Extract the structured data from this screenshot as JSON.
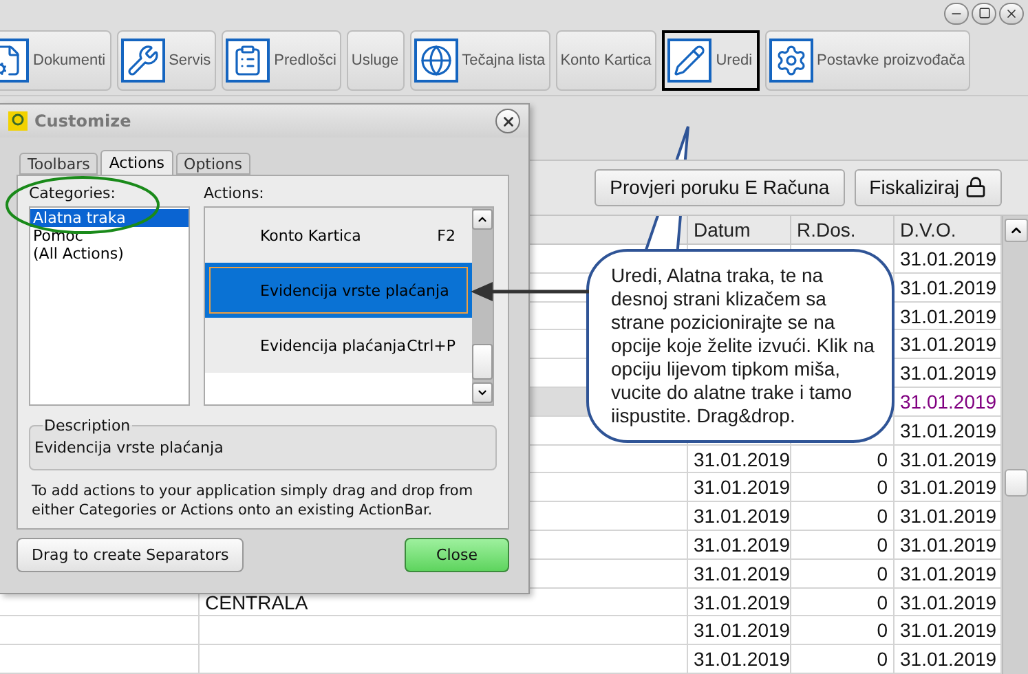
{
  "toolbar": [
    {
      "label": "Dokumenti",
      "kind": "icon",
      "selected": false
    },
    {
      "label": "Servis",
      "kind": "icon",
      "selected": false
    },
    {
      "label": "Predlošci",
      "kind": "icon",
      "selected": false
    },
    {
      "label": "Usluge",
      "kind": "text",
      "selected": false
    },
    {
      "label": "Tečajna lista",
      "kind": "icon",
      "selected": false
    },
    {
      "label": "Konto Kartica",
      "kind": "text",
      "selected": false
    },
    {
      "label": "Uredi",
      "kind": "icon",
      "selected": true
    },
    {
      "label": "Postavke proizvođača",
      "kind": "icon",
      "selected": false
    }
  ],
  "action_buttons": [
    {
      "label": "Provjeri poruku E Računa",
      "kind": "text"
    },
    {
      "label": "Fiskaliziraj",
      "kind": "lock"
    }
  ],
  "table": {
    "columns": [
      "Datum",
      "R.Dos.",
      "D.V.O."
    ],
    "rows": [
      {
        "dvo": "31.01.2019",
        "selected": false
      },
      {
        "dvo": "31.01.2019",
        "selected": false
      },
      {
        "dvo": "31.01.2019",
        "selected": false
      },
      {
        "dvo": "31.01.2019",
        "selected": false
      },
      {
        "dvo": "31.01.2019",
        "selected": false
      },
      {
        "dvo": "31.01.2019",
        "selected": true
      },
      {
        "dvo": "31.01.2019",
        "selected": false
      },
      {
        "datum": "31.01.2019",
        "r_dos": "0",
        "dvo": "31.01.2019",
        "selected": false
      },
      {
        "datum": "31.01.2019",
        "r_dos": "0",
        "dvo": "31.01.2019",
        "selected": false
      },
      {
        "datum": "31.01.2019",
        "r_dos": "0",
        "dvo": "31.01.2019",
        "selected": false
      },
      {
        "datum": "31.01.2019",
        "r_dos": "0",
        "dvo": "31.01.2019",
        "selected": false
      },
      {
        "datum": "31.01.2019",
        "r_dos": "0",
        "dvo": "31.01.2019",
        "selected": false
      },
      {
        "column_2": "CENTRALA",
        "datum": "31.01.2019",
        "r_dos": "0",
        "dvo": "31.01.2019",
        "selected": false
      },
      {
        "datum": "31.01.2019",
        "r_dos": "0",
        "dvo": "31.01.2019",
        "selected": false
      },
      {
        "datum": "31.01.2019",
        "r_dos": "0",
        "dvo": "31.01.2019",
        "selected": false
      }
    ]
  },
  "dialog": {
    "title": "Customize",
    "tabs": [
      {
        "label": "Toolbars",
        "selected": false
      },
      {
        "label": "Actions",
        "selected": true
      },
      {
        "label": "Options",
        "selected": false
      }
    ],
    "categories_label": "Categories:",
    "categories": [
      {
        "label": "Alatna traka",
        "selected": true
      },
      {
        "label": "Pomoc",
        "selected": false
      },
      {
        "label": "(All Actions)",
        "selected": false
      }
    ],
    "actions_label": "Actions:",
    "actions": [
      {
        "label": "Konto Kartica",
        "shortcut": "F2",
        "selected": false
      },
      {
        "label": "Evidencija vrste plaćanja",
        "selected": true
      },
      {
        "label": "Evidencija plaćanja",
        "shortcut": "Ctrl+P",
        "selected": false
      }
    ],
    "description_label": "Description",
    "description": "Evidencija vrste plaćanja",
    "help_text": "To add actions to your application simply drag and drop from either Categories or Actions onto an existing ActionBar.",
    "buttons": [
      {
        "label": "Drag to create Separators",
        "kind": "plain"
      },
      {
        "label": "Close",
        "kind": "primary"
      }
    ]
  },
  "callout": {
    "text": "Uredi, Alatna traka, te na desnoj strani klizačem sa strane pozicionirajte se na opcije koje želite izvući. Klik na opciju lijevom tipkom miša, vucite do alatne trake i tamo iispustite. Drag&drop."
  }
}
